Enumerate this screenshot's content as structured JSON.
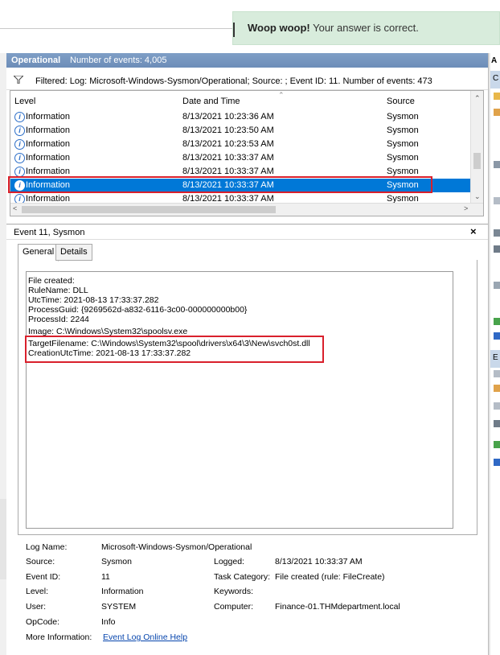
{
  "toast": {
    "strong": "Woop woop!",
    "text": " Your answer is correct."
  },
  "header": {
    "title": "Operational",
    "count": "Number of events: 4,005"
  },
  "filter": {
    "text": "Filtered: Log: Microsoft-Windows-Sysmon/Operational; Source: ; Event ID: 11. Number of events: 473"
  },
  "list": {
    "columns": [
      "Level",
      "Date and Time",
      "Source"
    ],
    "rows": [
      {
        "level": "Information",
        "date": "8/13/2021 10:23:36 AM",
        "source": "Sysmon"
      },
      {
        "level": "Information",
        "date": "8/13/2021 10:23:50 AM",
        "source": "Sysmon"
      },
      {
        "level": "Information",
        "date": "8/13/2021 10:23:53 AM",
        "source": "Sysmon"
      },
      {
        "level": "Information",
        "date": "8/13/2021 10:33:37 AM",
        "source": "Sysmon"
      },
      {
        "level": "Information",
        "date": "8/13/2021 10:33:37 AM",
        "source": "Sysmon"
      },
      {
        "level": "Information",
        "date": "8/13/2021 10:33:37 AM",
        "source": "Sysmon"
      },
      {
        "level": "Information",
        "date": "8/13/2021 10:33:37 AM",
        "source": "Sysmon"
      }
    ],
    "selected_index": 5
  },
  "details": {
    "title": "Event 11, Sysmon",
    "tabs": [
      "General",
      "Details"
    ],
    "lines": [
      "File created:",
      "RuleName: DLL",
      "UtcTime: 2021-08-13 17:33:37.282",
      "ProcessGuid: {9269562d-a832-6116-3c00-000000000b00}",
      "ProcessId: 2244",
      "Image: C:\\Windows\\System32\\spoolsv.exe",
      "TargetFilename: C:\\Windows\\System32\\spool\\drivers\\x64\\3\\New\\svch0st.dll",
      "CreationUtcTime: 2021-08-13 17:33:37.282"
    ],
    "props": {
      "log_name_label": "Log Name:",
      "log_name": "Microsoft-Windows-Sysmon/Operational",
      "source_label": "Source:",
      "source": "Sysmon",
      "logged_label": "Logged:",
      "logged": "8/13/2021 10:33:37 AM",
      "event_id_label": "Event ID:",
      "event_id": "11",
      "task_label": "Task Category:",
      "task": "File created (rule: FileCreate)",
      "level_label": "Level:",
      "level": "Information",
      "keywords_label": "Keywords:",
      "keywords": "",
      "user_label": "User:",
      "user": "SYSTEM",
      "computer_label": "Computer:",
      "computer": "Finance-01.THMdepartment.local",
      "opcode_label": "OpCode:",
      "opcode": "Info",
      "more_label": "More Information:",
      "more_link": "Event Log Online Help"
    }
  },
  "right_panel": {
    "header_letter": "A",
    "section_letter_1": "C",
    "section_letter_2": "E"
  },
  "colors": {
    "selected_row": "#0078d7",
    "toast_bg": "#d8ecdc",
    "highlight_box": "#d9202c"
  }
}
